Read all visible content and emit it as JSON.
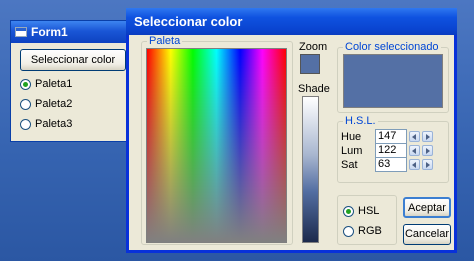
{
  "form1": {
    "title": "Form1",
    "button_label": "Seleccionar color",
    "radios": [
      {
        "label": "Paleta1",
        "selected": true
      },
      {
        "label": "Paleta2",
        "selected": false
      },
      {
        "label": "Paleta3",
        "selected": false
      }
    ]
  },
  "dialog": {
    "title": "Seleccionar color",
    "palette_label": "Paleta",
    "zoom_label": "Zoom",
    "shade_label": "Shade",
    "color_group_label": "Color seleccionado",
    "hsl_group_label": "H.S.L.",
    "hsl": [
      {
        "label": "Hue",
        "value": "147"
      },
      {
        "label": "Lum",
        "value": "122"
      },
      {
        "label": "Sat",
        "value": "63"
      }
    ],
    "mode_options": [
      {
        "label": "HSL",
        "selected": true
      },
      {
        "label": "RGB",
        "selected": false
      }
    ],
    "ok_label": "Aceptar",
    "cancel_label": "Cancelar",
    "selected_color": "#5470a5"
  }
}
